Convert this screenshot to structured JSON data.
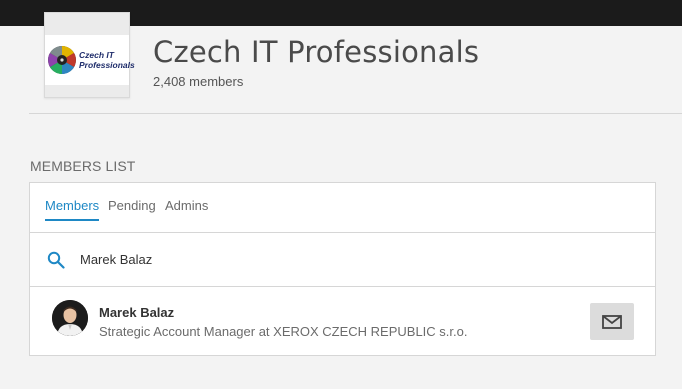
{
  "group": {
    "logo_text_line1": "Czech IT",
    "logo_text_line2": "Professionals",
    "title": "Czech IT Professionals",
    "member_count": "2,408 members"
  },
  "members_section": {
    "heading": "MEMBERS LIST",
    "tabs": [
      {
        "label": "Members",
        "active": true
      },
      {
        "label": "Pending",
        "active": false
      },
      {
        "label": "Admins",
        "active": false
      }
    ],
    "search": {
      "value": "Marek Balaz",
      "icon": "search-icon"
    },
    "results": [
      {
        "name": "Marek Balaz",
        "headline": "Strategic Account Manager at XEROX CZECH REPUBLIC s.r.o.",
        "action_icon": "envelope-icon"
      }
    ]
  },
  "colors": {
    "accent": "#1e88c5",
    "topbar": "#1b1b1b",
    "background": "#f3f3f3"
  }
}
